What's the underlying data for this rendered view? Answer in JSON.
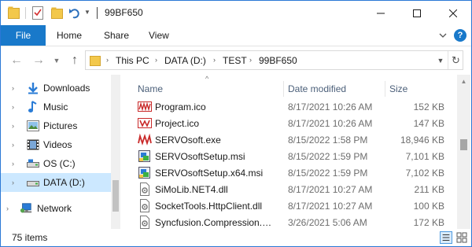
{
  "window": {
    "title": "99BF650",
    "controls": {
      "minimize": "minimize-icon",
      "maximize": "maximize-icon",
      "close": "close-icon"
    }
  },
  "ribbon": {
    "tabs": [
      "File",
      "Home",
      "Share",
      "View"
    ],
    "help": "?"
  },
  "address": {
    "breadcrumbs": [
      "This PC",
      "DATA (D:)",
      "TEST",
      "99BF650"
    ]
  },
  "nav_pane": {
    "items": [
      {
        "label": "Downloads",
        "icon": "download-arrow-icon",
        "expandable": true,
        "selected": false
      },
      {
        "label": "Music",
        "icon": "music-note-icon",
        "expandable": true,
        "selected": false
      },
      {
        "label": "Pictures",
        "icon": "pictures-icon",
        "expandable": true,
        "selected": false
      },
      {
        "label": "Videos",
        "icon": "film-icon",
        "expandable": true,
        "selected": false
      },
      {
        "label": "OS (C:)",
        "icon": "drive-icon",
        "expandable": true,
        "selected": false
      },
      {
        "label": "DATA (D:)",
        "icon": "drive-icon",
        "expandable": true,
        "selected": true
      },
      {
        "label": "Network",
        "icon": "network-icon",
        "expandable": true,
        "selected": false
      }
    ]
  },
  "file_list": {
    "columns": {
      "name": "Name",
      "date": "Date modified",
      "size": "Size"
    },
    "rows": [
      {
        "name": "Program.ico",
        "date": "8/17/2021 10:26 AM",
        "size": "152 KB",
        "icon": "servo-ico-icon"
      },
      {
        "name": "Project.ico",
        "date": "8/17/2021 10:26 AM",
        "size": "147 KB",
        "icon": "servo-ico-icon"
      },
      {
        "name": "SERVOsoft.exe",
        "date": "8/15/2022 1:58 PM",
        "size": "18,946 KB",
        "icon": "servo-exe-icon"
      },
      {
        "name": "SERVOsoftSetup.msi",
        "date": "8/15/2022 1:59 PM",
        "size": "7,101 KB",
        "icon": "msi-installer-icon"
      },
      {
        "name": "SERVOsoftSetup.x64.msi",
        "date": "8/15/2022 1:59 PM",
        "size": "7,102 KB",
        "icon": "msi-installer-icon"
      },
      {
        "name": "SiMoLib.NET4.dll",
        "date": "8/17/2021 10:27 AM",
        "size": "211 KB",
        "icon": "dll-file-icon"
      },
      {
        "name": "SocketTools.HttpClient.dll",
        "date": "8/17/2021 10:27 AM",
        "size": "100 KB",
        "icon": "dll-file-icon"
      },
      {
        "name": "Syncfusion.Compression.B...",
        "date": "3/26/2021 5:06 AM",
        "size": "172 KB",
        "icon": "dll-file-icon"
      }
    ]
  },
  "status": {
    "item_count": "75 items"
  }
}
